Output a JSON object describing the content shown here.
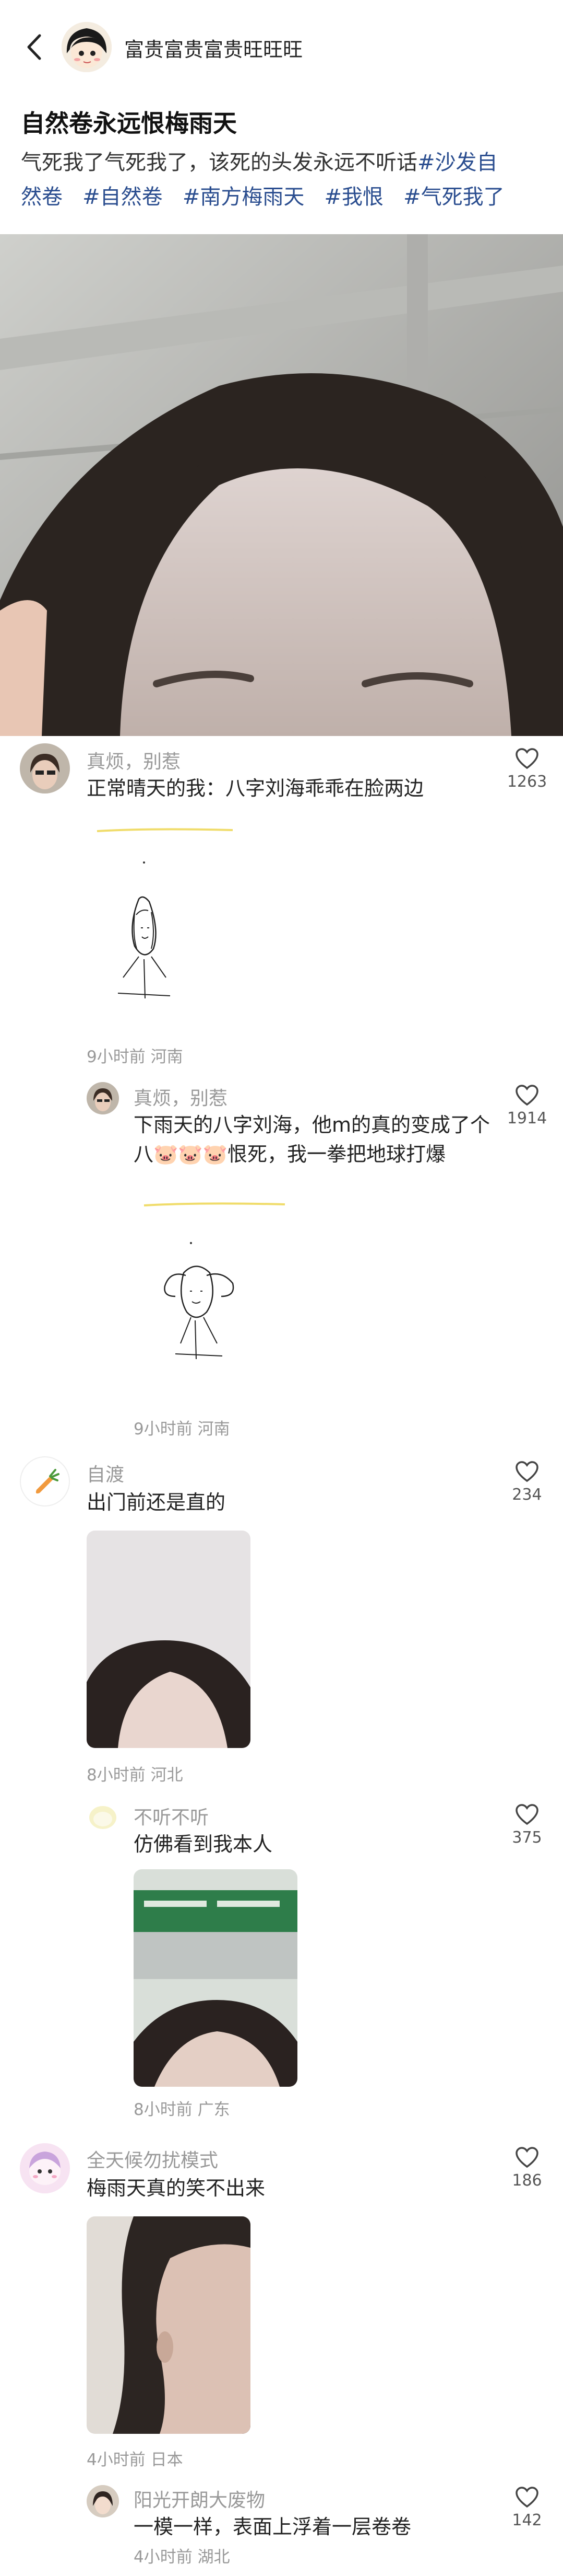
{
  "header": {
    "back_icon": "chevron-left-icon",
    "username": "富贵富贵富贵旺旺旺"
  },
  "post": {
    "title": "自然卷永远恨梅雨天",
    "text": "气死我了气死我了，该死的头发永远不听话",
    "tags": [
      "#沙发自然卷",
      "#自然卷",
      "#南方梅雨天",
      "#我恨",
      "#气死我了"
    ],
    "tag_line1": "#沙发自",
    "tag_line2": "然卷"
  },
  "comments": [
    {
      "name": "真烦，别惹",
      "text": "正常晴天的我：八字刘海乖乖在脸两边",
      "likes": "1263",
      "meta": "9小时前 河南",
      "reply": {
        "name": "真烦，别惹",
        "text1": "下雨天的八字刘海，他m的真的变成了个",
        "text2a": "八",
        "emoji": "🐷🐷🐷",
        "text2b": "恨死，我一拳把地球打爆",
        "likes": "1914",
        "meta": "9小时前 河南"
      }
    },
    {
      "name": "自渡",
      "text": "出门前还是直的",
      "likes": "234",
      "meta": "8小时前 河北",
      "reply": {
        "name": "不听不听",
        "text": "仿佛看到我本人",
        "likes": "375",
        "meta": "8小时前 广东"
      }
    },
    {
      "name": "全天候勿扰模式",
      "text": "梅雨天真的笑不出来",
      "likes": "186",
      "meta": "4小时前 日本",
      "reply": {
        "name": "阳光开朗大废物",
        "text": "一模一样，表面上浮着一层卷卷",
        "likes": "142",
        "meta": "4小时前 湖北"
      }
    }
  ],
  "icons": {
    "like": "heart-outline-icon",
    "carrot": "carrot-icon"
  },
  "colors": {
    "tag": "#2a4d8f",
    "meta": "#999999"
  }
}
